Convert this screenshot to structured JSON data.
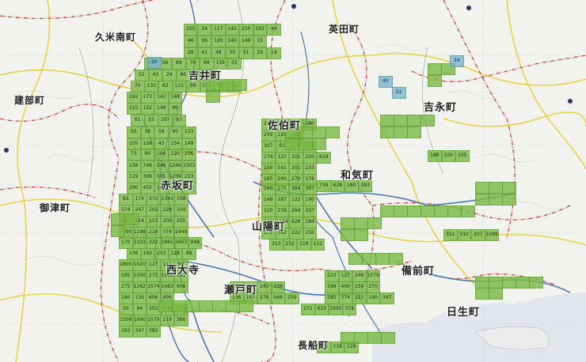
{
  "map": {
    "towns": [
      {
        "id": "kumenan",
        "label": "久米南町"
      },
      {
        "id": "aida",
        "label": "英田町"
      },
      {
        "id": "yoshii",
        "label": "吉井町"
      },
      {
        "id": "takebe",
        "label": "建部町"
      },
      {
        "id": "saeki",
        "label": "佐伯町"
      },
      {
        "id": "yoshinaga",
        "label": "吉永町"
      },
      {
        "id": "wake",
        "label": "和気町"
      },
      {
        "id": "akaiwa",
        "label": "赤坂町"
      },
      {
        "id": "mitsu",
        "label": "御津町"
      },
      {
        "id": "sanyo",
        "label": "山陽町"
      },
      {
        "id": "saidaiji",
        "label": "西大寺"
      },
      {
        "id": "seto",
        "label": "瀬戸町"
      },
      {
        "id": "bizen",
        "label": "備前町"
      },
      {
        "id": "hinase",
        "label": "日生町"
      },
      {
        "id": "osafune",
        "label": "長船町"
      }
    ],
    "colors": {
      "cell_green": "#7aba46",
      "cell_blue": "#76b2d6",
      "boundary_red": "#d2453a",
      "road_yellow": "#e9d23a",
      "rail_blue": "#4a74b8",
      "sea": "#e3e6ee"
    },
    "cells": {
      "green": [
        [
          "105",
          "54",
          "117",
          "142",
          "210",
          "253",
          "44"
        ],
        [
          "46",
          "99",
          "120",
          "140",
          "149",
          "15"
        ],
        [
          "28",
          "41",
          "48",
          "30",
          "51",
          "29",
          "14"
        ],
        [
          "62",
          "58",
          "89",
          "70",
          "99",
          "159",
          "33"
        ],
        [
          "52",
          "43",
          "24",
          "86",
          "163",
          "45"
        ],
        [
          "70",
          "133",
          "82",
          "115",
          "99",
          "197",
          "62",
          "14"
        ],
        [
          "192",
          "173",
          "142",
          "148",
          "241",
          "302",
          "81",
          "280"
        ],
        [
          "115",
          "122",
          "148",
          "96",
          "209",
          "129",
          "98"
        ],
        [
          "61",
          "55",
          "107",
          "87",
          "307",
          "91",
          "115",
          "178"
        ],
        [
          "50",
          "38",
          "58",
          "90",
          "133",
          "174",
          "127",
          "101",
          "220",
          "619"
        ],
        [
          "105",
          "128",
          "43",
          "154",
          "149",
          "156",
          "161",
          "201",
          "233"
        ],
        [
          "73",
          "90",
          "160",
          "120",
          "256",
          "185",
          "200",
          "270",
          "176"
        ],
        [
          "136",
          "748",
          "246",
          "1266",
          "1303",
          "160",
          "275",
          "384",
          "357"
        ],
        [
          "129",
          "306",
          "505",
          "1209",
          "253",
          "149",
          "187",
          "122",
          "190"
        ],
        [
          "290",
          "455",
          "105",
          "126",
          "182",
          "120",
          "278",
          "264",
          "137"
        ],
        [
          "93",
          "174",
          "372",
          "1341",
          "358",
          "116",
          "1164",
          "628",
          "184"
        ],
        [
          "374",
          "247",
          "202",
          "228",
          "104",
          "172",
          "382",
          "222",
          "250"
        ],
        [
          "133",
          "214",
          "153",
          "200",
          "205",
          "313",
          "252",
          "118",
          "112"
        ],
        [
          "1090",
          "1198",
          "216",
          "374",
          "2449",
          "225",
          "84",
          "142",
          "238"
        ],
        [
          "170",
          "1103",
          "222",
          "1881",
          "1863",
          "248",
          "136",
          "167",
          "276",
          "566",
          "250"
        ],
        [
          "136",
          "193",
          "253",
          "128",
          "88",
          "272",
          "623",
          "1000",
          "374"
        ],
        [
          "1800",
          "1020",
          "127",
          "143",
          "98",
          "223",
          "127",
          "246",
          "1579"
        ],
        [
          "195",
          "1300",
          "271",
          "1099",
          "121",
          "199",
          "400",
          "150",
          "270"
        ],
        [
          "275",
          "1262",
          "1574",
          "1483",
          "606",
          "739",
          "628",
          "180",
          "283"
        ],
        [
          "160",
          "130",
          "606",
          "406",
          "188",
          "100",
          "105"
        ],
        [
          "50",
          "94",
          "102",
          "1099",
          "774",
          "351",
          "510",
          "207",
          "1099"
        ],
        [
          "1509",
          "1000",
          "1579",
          "119",
          "366",
          "185",
          "374",
          "215",
          "190",
          "347"
        ],
        [
          "193",
          "347",
          "382",
          "164",
          "118",
          "129"
        ]
      ],
      "blue": [
        "34",
        "30",
        "40",
        "52"
      ]
    }
  }
}
